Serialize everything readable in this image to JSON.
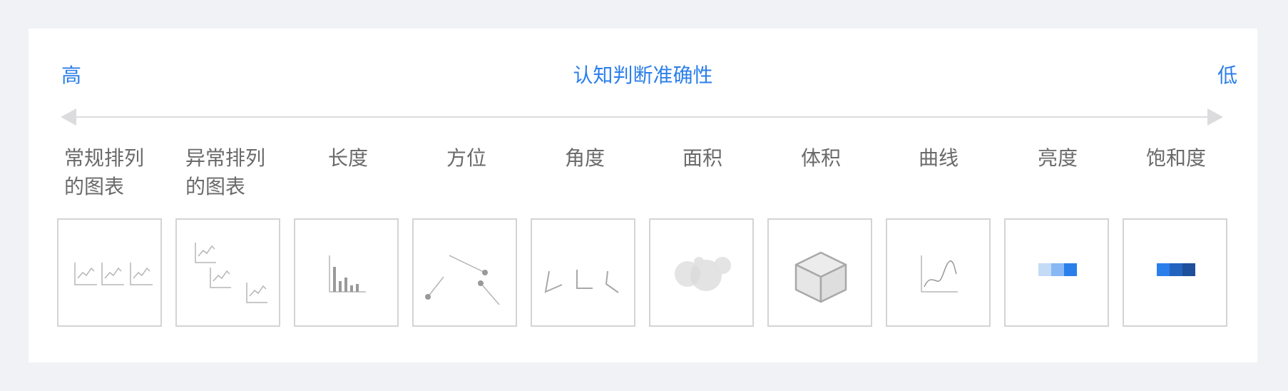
{
  "scale": {
    "high_label": "高",
    "title": "认知判断准确性",
    "low_label": "低"
  },
  "columns": [
    {
      "line1": "常规排列",
      "line2": "的图表",
      "icon": "regular-charts-icon"
    },
    {
      "line1": "异常排列",
      "line2": "的图表",
      "icon": "irregular-charts-icon"
    },
    {
      "line1": "长度",
      "icon": "length-bars-icon"
    },
    {
      "line1": "方位",
      "icon": "position-icon"
    },
    {
      "line1": "角度",
      "icon": "angle-icon"
    },
    {
      "line1": "面积",
      "icon": "area-circles-icon"
    },
    {
      "line1": "体积",
      "icon": "volume-cube-icon"
    },
    {
      "line1": "曲线",
      "icon": "curve-icon"
    },
    {
      "line1": "亮度",
      "icon": "lightness-swatch-icon"
    },
    {
      "line1": "饱和度",
      "icon": "saturation-swatch-icon"
    }
  ],
  "colors": {
    "accent": "#2b7fea",
    "lightness": [
      "#c3dbf7",
      "#88b7f4",
      "#2b7fea"
    ],
    "saturation": [
      "#2b7fea",
      "#2462bf",
      "#1e4f9a"
    ]
  }
}
